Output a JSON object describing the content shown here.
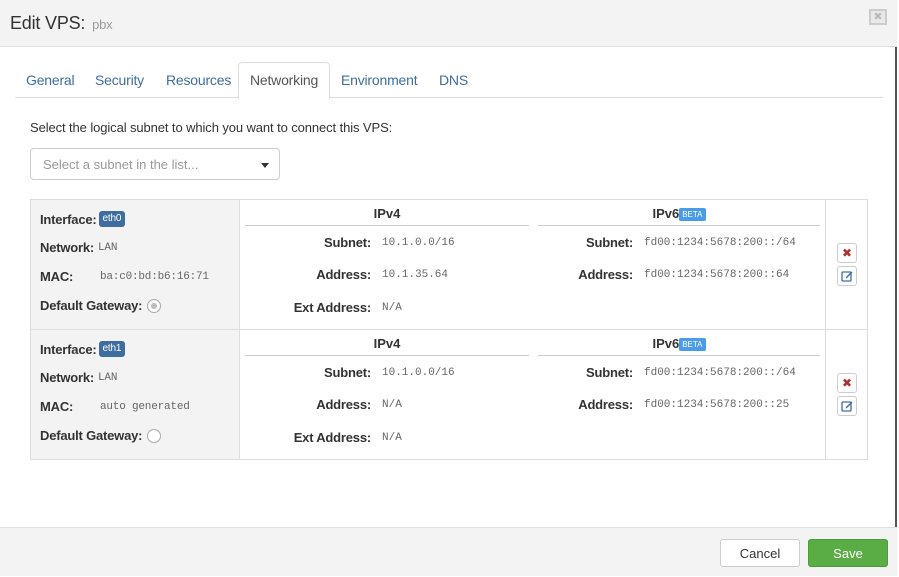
{
  "header": {
    "title": "Edit VPS:",
    "subtitle": "pbx",
    "close_icon": "close-icon"
  },
  "tabs": [
    {
      "label": "General",
      "active": false
    },
    {
      "label": "Security",
      "active": false
    },
    {
      "label": "Resources",
      "active": false
    },
    {
      "label": "Networking",
      "active": true
    },
    {
      "label": "Environment",
      "active": false
    },
    {
      "label": "DNS",
      "active": false
    }
  ],
  "networking": {
    "intro": "Select the logical subnet to which you want to connect this VPS:",
    "subnet_select": {
      "placeholder": "Select a subnet in the list...",
      "value": ""
    },
    "labels": {
      "interface": "Interface:",
      "network": "Network:",
      "mac": "MAC:",
      "default_gateway": "Default Gateway:",
      "ipv4": "IPv4",
      "ipv6": "IPv6",
      "beta": "BETA",
      "subnet": "Subnet:",
      "address": "Address:",
      "ext_address": "Ext Address:"
    },
    "interfaces": [
      {
        "name": "eth0",
        "network": "LAN",
        "mac": "ba:c0:bd:b6:16:71",
        "default_gateway": true,
        "ipv4": {
          "subnet": "10.1.0.0/16",
          "address": "10.1.35.64",
          "ext_address": "N/A"
        },
        "ipv6": {
          "subnet": "fd00:1234:5678:200::/64",
          "address": "fd00:1234:5678:200::64"
        },
        "delete_icon": "delete-icon",
        "edit_icon": "edit-icon"
      },
      {
        "name": "eth1",
        "network": "LAN",
        "mac": "auto generated",
        "default_gateway": false,
        "ipv4": {
          "subnet": "10.1.0.0/16",
          "address": "N/A",
          "ext_address": "N/A"
        },
        "ipv6": {
          "subnet": "fd00:1234:5678:200::/64",
          "address": "fd00:1234:5678:200::25"
        },
        "delete_icon": "delete-icon",
        "edit_icon": "edit-icon"
      }
    ]
  },
  "footer": {
    "cancel_label": "Cancel",
    "save_label": "Save"
  },
  "colors": {
    "tab_link": "#3f6d9f",
    "badge": "#3f6d9f",
    "beta_badge": "#4a9be8",
    "save_button": "#5aac44",
    "delete_icon": "#b03030"
  }
}
